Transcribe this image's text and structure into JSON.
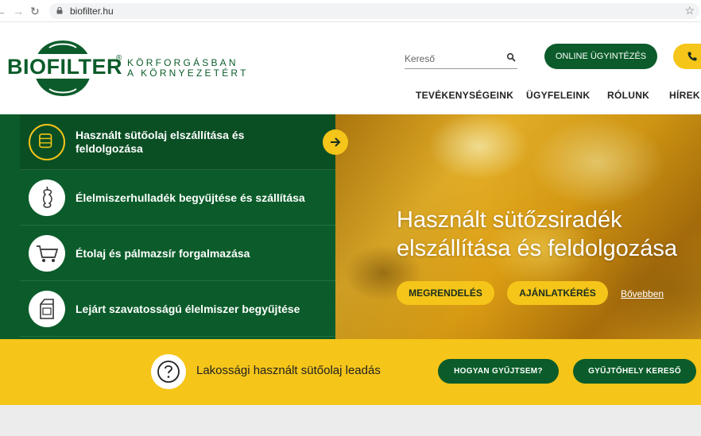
{
  "browser": {
    "back_glyph": "←",
    "forward_glyph": "→",
    "reload_glyph": "↻",
    "url": "biofilter.hu",
    "star_glyph": "☆"
  },
  "brand": {
    "name": "BIOFILTER",
    "registered": "®",
    "tagline_line1": "KÖRFORGÁSBAN",
    "tagline_line2": "A KÖRNYEZETÉRT",
    "color_green": "#0b5c2a",
    "color_yellow": "#f5c519"
  },
  "header": {
    "search_placeholder": "Kereső",
    "online_button": "ONLINE ÜGYINTÉZÉS",
    "nav": [
      {
        "label": "TEVÉKENYSÉGEINK"
      },
      {
        "label": "ÜGYFELEINK"
      },
      {
        "label": "RÓLUNK"
      },
      {
        "label": "HÍREK"
      }
    ]
  },
  "services": [
    {
      "label": "Használt sütőolaj elszállítása és feldolgozása",
      "icon": "oil-barrel-icon",
      "active": true
    },
    {
      "label": "Élelmiszerhulladék begyűjtése és szállítása",
      "icon": "apple-core-icon",
      "active": false
    },
    {
      "label": "Étolaj és pálmazsír forgalmazása",
      "icon": "shopping-cart-icon",
      "active": false
    },
    {
      "label": "Lejárt szavatosságú élelmiszer begyűjtése",
      "icon": "milk-carton-icon",
      "active": false
    }
  ],
  "hero": {
    "title": "Használt sütőzsiradék elszállítása és feldolgozása",
    "order_button": "MEGRENDELÉS",
    "quote_button": "AJÁNLATKÉRÉS",
    "more_link": "Bővebben"
  },
  "band": {
    "text": "Lakossági használt sütőolaj leadás",
    "how_button": "HOGYAN GYŰJTSEM?",
    "finder_button": "GYŰJTŐHELY KERESŐ"
  }
}
